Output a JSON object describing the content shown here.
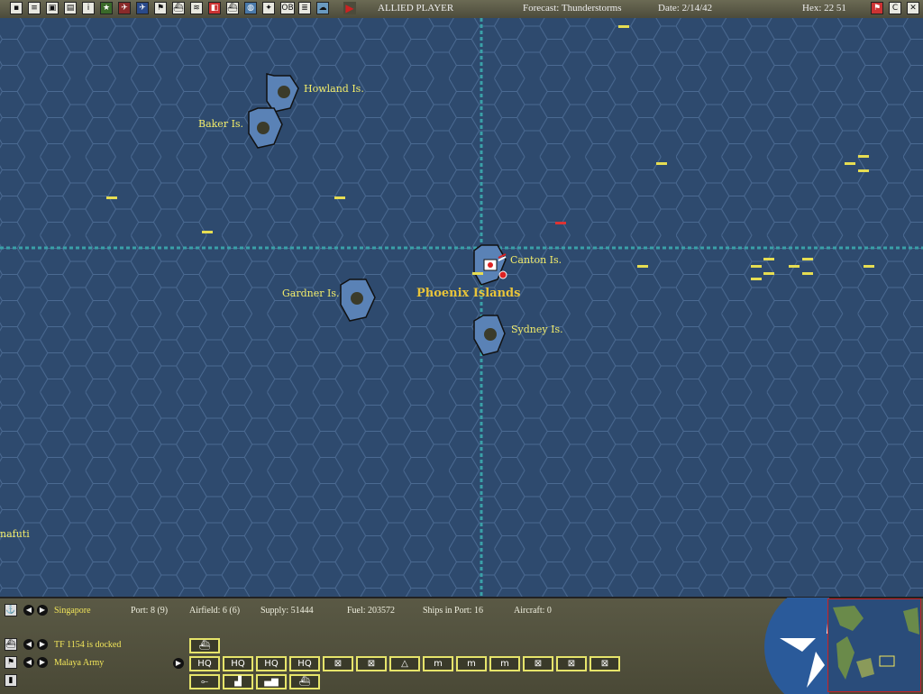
{
  "topbar": {
    "player": "ALLIED PLAYER",
    "forecast": "Forecast: Thunderstorms",
    "date": "Date: 2/14/42",
    "hex": "Hex: 22 51",
    "right_icons": [
      "flag-icon",
      "C",
      "X"
    ]
  },
  "map": {
    "labels": {
      "howland": "Howland Is.",
      "baker": "Baker Is.",
      "canton": "Canton Is.",
      "gardner": "Gardner Is.",
      "phoenix": "Phoenix Islands",
      "sydney": "Sydney Is.",
      "funafuti": "nafuti"
    }
  },
  "bottom": {
    "base": "Singapore",
    "port": "Port: 8 (9)",
    "airfield": "Airfield: 6 (6)",
    "supply": "Supply: 51444",
    "fuel": "Fuel: 203572",
    "ships_in_port": "Ships in Port: 16",
    "aircraft": "Aircraft: 0",
    "taskforce": "TF 1154 is docked",
    "army": "Malaya Army",
    "units": [
      "HQ",
      "HQ",
      "HQ",
      "HQ",
      "⊠",
      "⊠",
      "△",
      "m",
      "m",
      "m",
      "⊠",
      "⊠",
      "⊠"
    ]
  }
}
